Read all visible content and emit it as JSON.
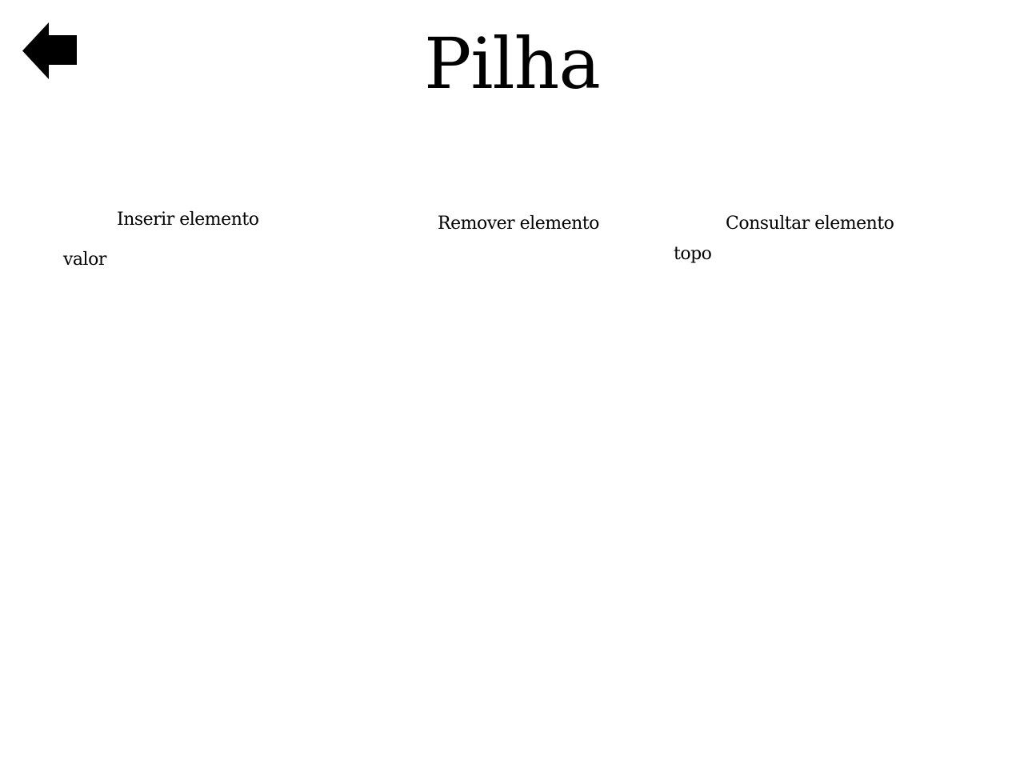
{
  "header": {
    "back_icon": "arrow-left-icon",
    "title": "Pilha"
  },
  "operations": {
    "insert": {
      "button_label": "Inserir elemento",
      "field_label": "valor"
    },
    "remove": {
      "button_label": "Remover elemento"
    },
    "peek": {
      "button_label": "Consultar elemento",
      "field_label": "topo"
    }
  },
  "colors": {
    "background": "#ffffff",
    "foreground": "#000000"
  }
}
